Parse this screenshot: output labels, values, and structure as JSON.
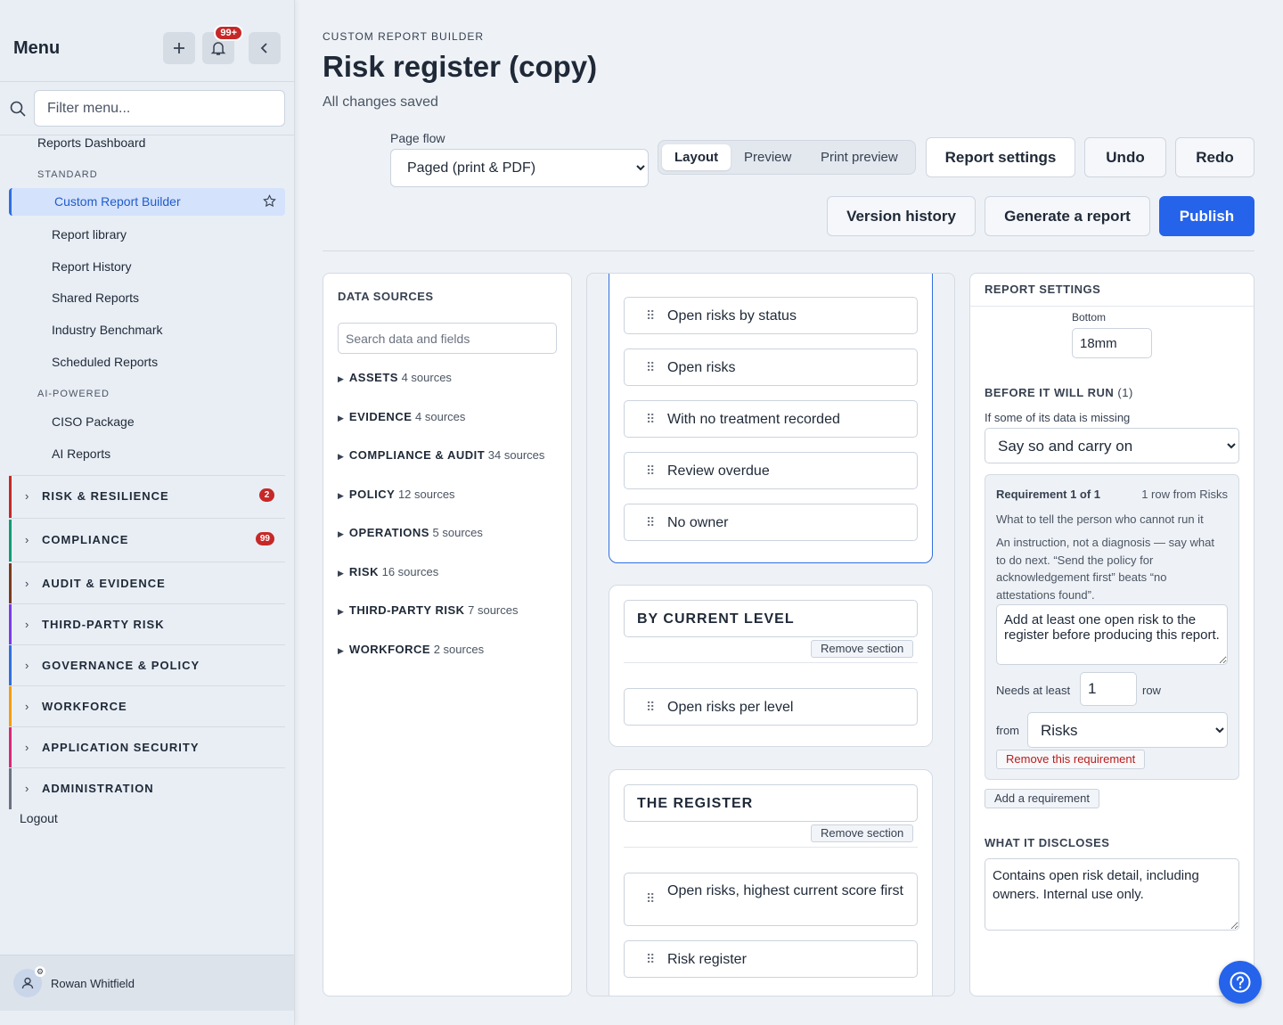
{
  "sidebar": {
    "title": "Menu",
    "notif_count": "99+",
    "filter_placeholder": "Filter menu...",
    "top_link": "Reports Dashboard",
    "standard_label": "STANDARD",
    "active_item": "Custom Report Builder",
    "standard_items": [
      "Report library",
      "Report History",
      "Shared Reports",
      "Industry Benchmark",
      "Scheduled Reports"
    ],
    "ai_label": "AI-POWERED",
    "ai_items": [
      "CISO Package",
      "AI Reports"
    ],
    "categories": [
      {
        "label": "RISK & RESILIENCE",
        "count": "2",
        "color": "#c62828"
      },
      {
        "label": "COMPLIANCE",
        "count": "99",
        "color": "#0f9d74"
      },
      {
        "label": "AUDIT & EVIDENCE",
        "count": "",
        "color": "#7c3a1e"
      },
      {
        "label": "THIRD-PARTY RISK",
        "count": "",
        "color": "#7c3aed"
      },
      {
        "label": "GOVERNANCE & POLICY",
        "count": "",
        "color": "#2f6fe0"
      },
      {
        "label": "WORKFORCE",
        "count": "",
        "color": "#f59e0b"
      },
      {
        "label": "APPLICATION SECURITY",
        "count": "",
        "color": "#db2777"
      },
      {
        "label": "ADMINISTRATION",
        "count": "",
        "color": "#6b7280"
      }
    ],
    "logout": "Logout",
    "user_name": "Rowan Whitfield"
  },
  "header": {
    "eyebrow": "CUSTOM REPORT BUILDER",
    "title": "Risk register (copy)",
    "status": "All changes saved",
    "page_flow_label": "Page flow",
    "page_flow_value": "Paged (print & PDF)",
    "tabs": [
      "Layout",
      "Preview",
      "Print preview"
    ],
    "active_tab": "Layout",
    "report_settings": "Report settings",
    "undo": "Undo",
    "redo": "Redo",
    "version_history": "Version history",
    "generate": "Generate a report",
    "publish": "Publish"
  },
  "data_sources": {
    "title": "DATA SOURCES",
    "search_placeholder": "Search data and fields",
    "groups": [
      {
        "name": "ASSETS",
        "count": "4 sources"
      },
      {
        "name": "EVIDENCE",
        "count": "4 sources"
      },
      {
        "name": "COMPLIANCE & AUDIT",
        "count": "34 sources"
      },
      {
        "name": "POLICY",
        "count": "12 sources"
      },
      {
        "name": "OPERATIONS",
        "count": "5 sources"
      },
      {
        "name": "RISK",
        "count": "16 sources"
      },
      {
        "name": "THIRD-PARTY RISK",
        "count": "7 sources"
      },
      {
        "name": "WORKFORCE",
        "count": "2 sources"
      }
    ]
  },
  "canvas": {
    "section1_blocks": [
      "Open risks by status",
      "Open risks",
      "With no treatment recorded",
      "Review overdue",
      "No owner"
    ],
    "section2_title": "BY CURRENT LEVEL",
    "section2_blocks": [
      "Open risks per level"
    ],
    "section3_title": "THE REGISTER",
    "section3_blocks": [
      "Open risks, highest current score first",
      "Risk register"
    ],
    "remove_section": "Remove section"
  },
  "report_settings": {
    "title": "REPORT SETTINGS",
    "bottom_label": "Bottom",
    "bottom_value": "18mm",
    "before_run_label": "BEFORE IT WILL RUN",
    "before_run_count": "(1)",
    "missing_label": "If some of its data is missing",
    "missing_value": "Say so and carry on",
    "req_title": "Requirement 1 of 1",
    "req_source": "1 row from Risks",
    "req_question": "What to tell the person who cannot run it",
    "req_hint": "An instruction, not a diagnosis — say what to do next. “Send the policy for acknowledgement first” beats “no attestations found”.",
    "req_message": "Add at least one open risk to the register before producing this report.",
    "needs_label": "Needs at least",
    "needs_value": "1",
    "row_label": "row",
    "from_label": "from",
    "from_value": "Risks",
    "remove_req": "Remove this requirement",
    "add_req": "Add a requirement",
    "discloses_label": "WHAT IT DISCLOSES",
    "discloses_value": "Contains open risk detail, including owners. Internal use only."
  }
}
